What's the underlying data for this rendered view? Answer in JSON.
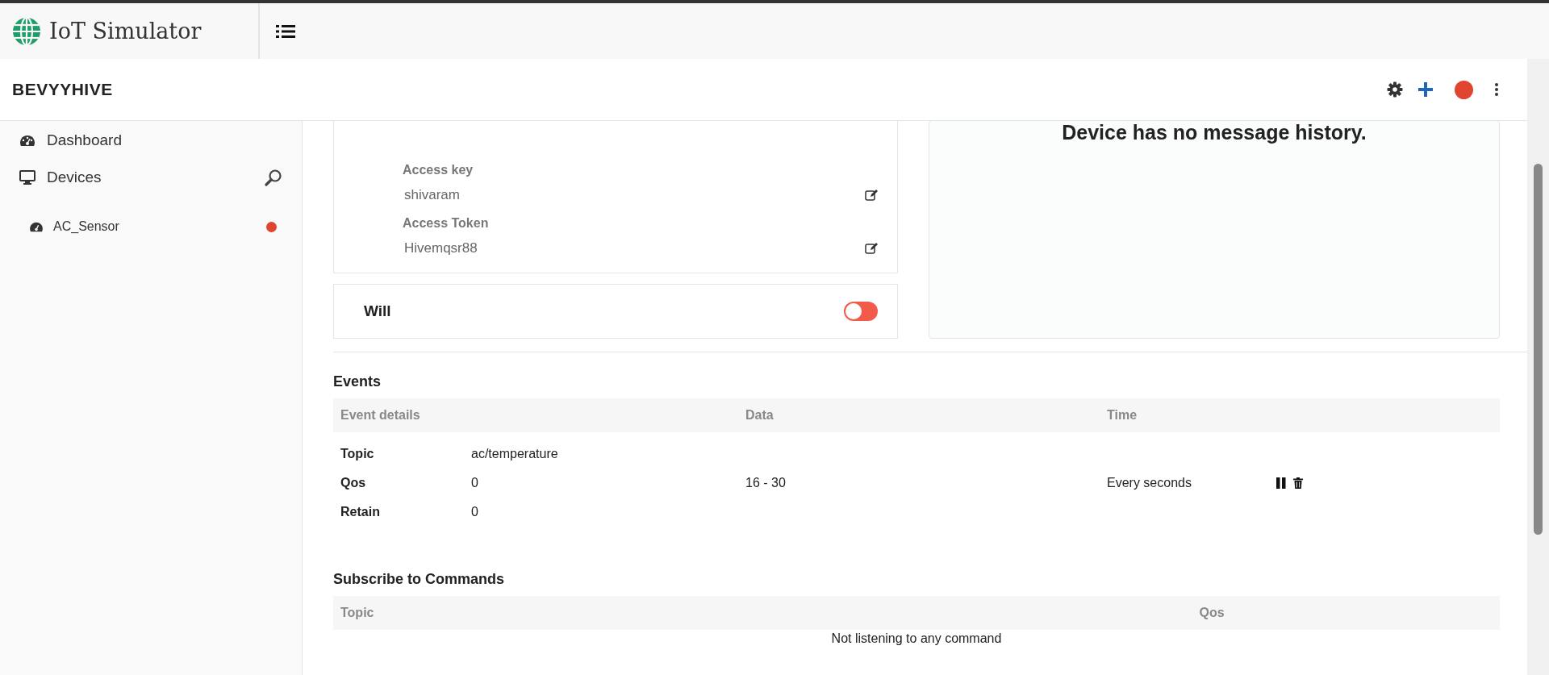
{
  "app": {
    "title": "IoT Simulator"
  },
  "header": {
    "title": "BEVYYHIVE"
  },
  "sidebar": {
    "items": [
      {
        "label": "Dashboard",
        "kind": "dashboard"
      },
      {
        "label": "Devices",
        "kind": "devices",
        "children": [
          {
            "label": "AC_Sensor",
            "color": "#e0452f"
          }
        ]
      }
    ]
  },
  "credentials": [
    {
      "label": "Access key",
      "value": "shivaram"
    },
    {
      "label": "Access Token",
      "value": "Hivemqsr88"
    }
  ],
  "will": {
    "label": "Will",
    "on": false
  },
  "history": {
    "message": "Device has no message history."
  },
  "events": {
    "title": "Events",
    "columns": [
      "Event details",
      "Data",
      "Time"
    ],
    "rows": [
      {
        "details": [
          {
            "label": "Topic",
            "value": "ac/temperature"
          },
          {
            "label": "Qos",
            "value": "0"
          },
          {
            "label": "Retain",
            "value": "0"
          }
        ],
        "data": "16 - 30",
        "time": "Every seconds"
      }
    ]
  },
  "commands": {
    "title": "Subscribe to Commands",
    "columns": [
      "Topic",
      "Qos"
    ],
    "empty": "Not listening to any command"
  }
}
